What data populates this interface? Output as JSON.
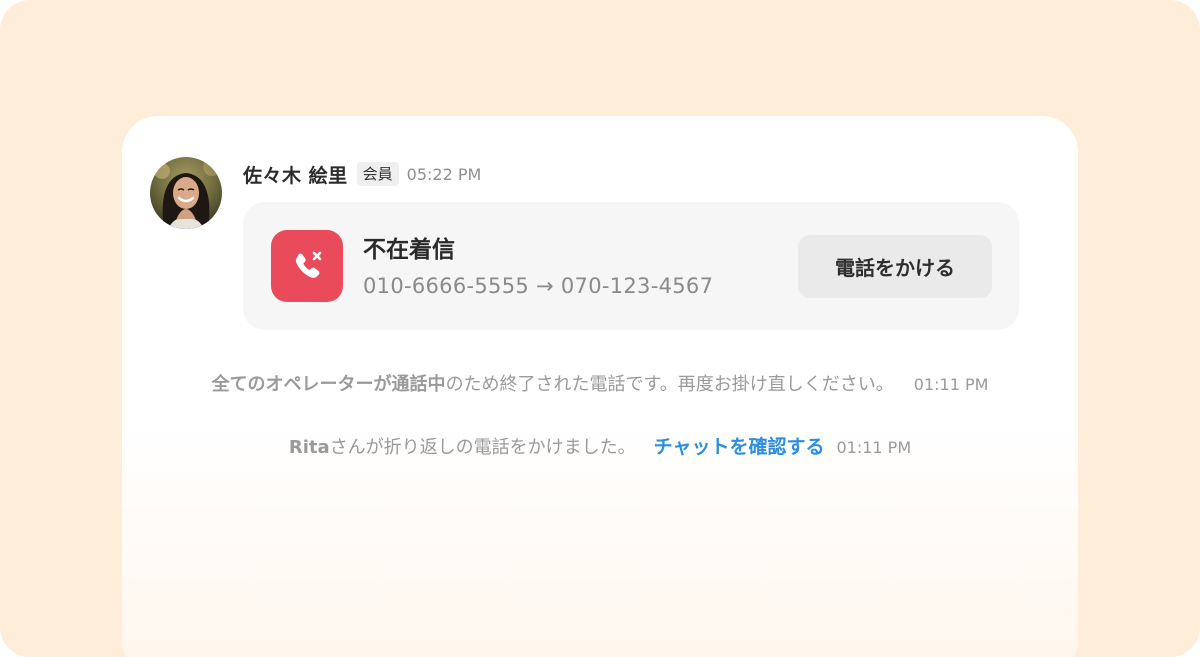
{
  "message": {
    "sender_name": "佐々木 絵里",
    "badge": "会員",
    "time": "05:22 PM",
    "avatar_icon": "user-avatar"
  },
  "call_card": {
    "icon": "missed-call-icon",
    "icon_bg": "#E94B5B",
    "title": "不在着信",
    "route": "010-6666-5555 → 070-123-4567",
    "button_label": "電話をかける"
  },
  "system_messages": [
    {
      "strong": "全てのオペレーターが通話中",
      "text": "のため終了された電話です。再度お掛け直しください。",
      "time": "01:11 PM"
    },
    {
      "strong": "Rita",
      "text": "さんが折り返しの電話をかけました。",
      "link": "チャットを確認する",
      "time": "01:11 PM"
    }
  ],
  "colors": {
    "background": "#FEEDD8",
    "link": "#2C8EDC",
    "missed_call": "#E94B5B"
  }
}
